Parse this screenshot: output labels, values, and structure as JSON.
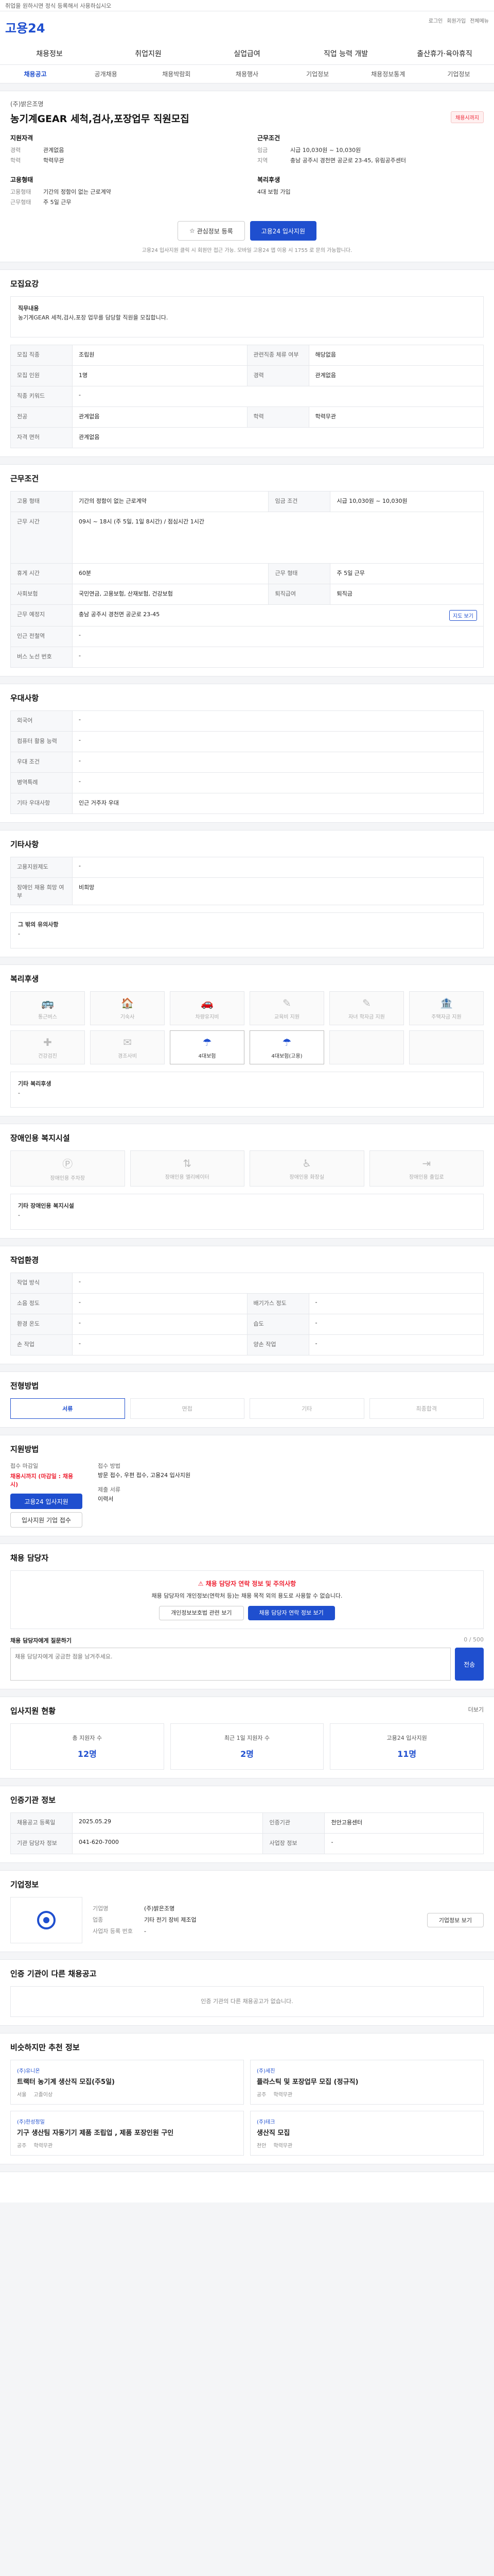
{
  "topbar": {
    "notice": "취업을 원하시면 정식 등록해서 사용하십시오"
  },
  "header": {
    "logo": "고용24",
    "right": [
      "로그인",
      "회원가입",
      "전체메뉴"
    ]
  },
  "gnb": [
    "채용정보",
    "취업지원",
    "실업급여",
    "직업 능력 개발",
    "출산휴가·육아휴직"
  ],
  "gnb2": [
    "채용공고",
    "공개채용",
    "채용박람회",
    "채용행사",
    "기업정보",
    "채용정보통계",
    "기업정보"
  ],
  "job": {
    "company": "(주)밝은조명",
    "title": "농기계GEAR 세척,검사,포장업무 직원모집",
    "badge": "채용시까지",
    "left_head": "지원자격",
    "left_kv": [
      {
        "k": "경력",
        "v": "관계없음"
      },
      {
        "k": "학력",
        "v": "학력무관"
      }
    ],
    "left2_head": "고용형태",
    "left2_kv": [
      {
        "k": "고용형태",
        "v": "기간의 정함이 없는 근로계약"
      },
      {
        "k": "근무형태",
        "v": "주 5일 근무"
      }
    ],
    "right_head": "근무조건",
    "right_kv": [
      {
        "k": "임금",
        "v": "시급 10,030원 ~ 10,030원"
      },
      {
        "k": "지역",
        "v": "충남 공주시 경천면 공군로 23-45, 유림공주센터"
      }
    ],
    "right2_head": "복리후생",
    "right2_kv": [
      {
        "k": "",
        "v": "4대 보험 가입"
      }
    ],
    "btn_scrap": "관심정보 등록",
    "btn_apply": "고용24 입사지원",
    "note": "고용24 입사지원 클릭 시 회원만 접근 가능. 모바일 고용24 앱 이용 시 1755 로 문의 가능합니다."
  },
  "recruit": {
    "title": "모집요강",
    "desc_head": "직무내용",
    "desc": "농기계GEAR 세척,검사,포장 업무를 담당할 직원을 모집합니다.",
    "rows": [
      [
        "모집 직종",
        "조립원",
        "관련직종 체류 여부",
        "해당없음"
      ],
      [
        "모집 인원",
        "1명",
        "경력",
        "관계없음"
      ],
      [
        "직종 키워드",
        "-",
        "",
        ""
      ],
      [
        "전공",
        "관계없음",
        "학력",
        "학력무관"
      ],
      [
        "자격 면허",
        "관계없음",
        "",
        ""
      ]
    ]
  },
  "work": {
    "title": "근무조건",
    "rows": [
      [
        "고용 형태",
        "기간의 정함이 없는 근로계약",
        "임금 조건",
        "시급 10,030원 ~ 10,030원"
      ],
      [
        "근무 시간",
        "09시 ~ 18시 (주 5일, 1일 8시간) / 점심시간 1시간",
        "",
        ""
      ],
      [
        "휴게 시간",
        "60분",
        "근무 형태",
        "주 5일 근무"
      ],
      [
        "사회보험",
        "국민연금, 고용보험, 산재보험, 건강보험",
        "퇴직급여",
        "퇴직금"
      ],
      [
        "근무 예정지",
        "충남 공주시 경천면 공군로 23-45",
        "",
        ""
      ],
      [
        "인근 전철역",
        "-",
        "",
        ""
      ],
      [
        "버스 노선 번호",
        "-",
        "",
        ""
      ]
    ],
    "map_btn": "지도 보기"
  },
  "pref": {
    "title": "우대사항",
    "rows": [
      [
        "외국어",
        "-"
      ],
      [
        "컴퓨터 활용 능력",
        "-"
      ],
      [
        "우대 조건",
        "-"
      ],
      [
        "병역특례",
        "-"
      ],
      [
        "기타 우대사항",
        "인근 거주자 우대"
      ]
    ]
  },
  "etc": {
    "title": "기타사항",
    "rows": [
      [
        "고용지원제도",
        "-"
      ],
      [
        "장애인 채용 희망 여부",
        "비희망"
      ]
    ],
    "apply_notes_head": "그 밖의 유의사항",
    "apply_notes": "-"
  },
  "welfare": {
    "title": "복리후생",
    "items": [
      "통근버스",
      "기숙사",
      "차량유지비",
      "교육비 지원",
      "자녀 학자금 지원",
      "주택자금 지원",
      "건강검진",
      "경조사비",
      "4대보험",
      "4대보험(고용)",
      "",
      ""
    ],
    "active": [
      8,
      9
    ],
    "etc_label": "기타 복리후생",
    "etc_value": "-"
  },
  "disabled": {
    "title": "장애인용 복지시설",
    "items": [
      "장애인용 주차장",
      "장애인용 엘리베이터",
      "장애인용 화장실",
      "장애인용 출입로"
    ],
    "etc_label": "기타 장애인용 복지시설",
    "etc_value": "-"
  },
  "workplace": {
    "title": "작업환경",
    "rows": [
      [
        "작업 방식",
        "-",
        "",
        ""
      ],
      [
        "소음 정도",
        "-",
        "배기가스 정도",
        "-"
      ],
      [
        "환경 온도",
        "-",
        "습도",
        "-"
      ],
      [
        "손 작업",
        "-",
        "양손 작업",
        "-"
      ]
    ]
  },
  "process": {
    "title": "전형방법",
    "steps": [
      "서류",
      "면접",
      "기타",
      "최종합격"
    ]
  },
  "apply": {
    "title": "지원방법",
    "deadline_label": "접수 마감일",
    "deadline": "채용시까지 (마감일 : 채용 시)",
    "btn": "고용24 입사지원",
    "btn2": "입사지원 기업 접수",
    "method_label": "접수 방법",
    "method": "방문 접수, 우편 접수, 고용24 입사지원",
    "docs_label": "제출 서류",
    "docs": "이력서"
  },
  "warn": {
    "title": "채용 담당자",
    "red": "채용 담당자 연락 정보 및 주의사항",
    "text": "채용 담당자의 개인정보(연락처 등)는 채용 목적 외의 용도로 사용할 수 없습니다.",
    "btn1": "개인정보보호법 관련 보기",
    "btn2": "채용 담당자 연락 정보 보기"
  },
  "inquiry": {
    "title": "채용 담당자에게 질문하기",
    "limit": "0 / 500",
    "placeholder": "채용 담당자에게 궁금한 점을 남겨주세요.",
    "btn": "전송"
  },
  "stats": {
    "title": "입사지원 현황",
    "more": "더보기",
    "items": [
      {
        "label": "총 지원자 수",
        "value": "12명"
      },
      {
        "label": "최근 1일 지원자 수",
        "value": "2명"
      },
      {
        "label": "고용24 입사지원",
        "value": "11명"
      }
    ]
  },
  "agency": {
    "title": "인증기관 정보",
    "rows": [
      [
        "채용공고 등록일",
        "2025.05.29",
        "인증기관",
        "천안고용센터"
      ],
      [
        "기관 담당자 정보",
        "041-620-7000",
        "사업장 정보",
        "-"
      ]
    ]
  },
  "company": {
    "title": "기업정보",
    "rows": [
      [
        "기업명",
        "(주)밝은조명"
      ],
      [
        "업종",
        "기타 전기 장비 제조업"
      ],
      [
        "사업자 등록 번호",
        "-"
      ]
    ],
    "btn": "기업정보 보기"
  },
  "others": {
    "title": "인증 기관이 다른 채용공고",
    "empty": "인증 기관의 다른 채용공고가 없습니다."
  },
  "similar": {
    "title": "비슷하지만 추천 정보",
    "cards": [
      {
        "co": "(주)유니온",
        "title": "트랙터 농기계 생산직 모집(주5일)",
        "meta": [
          "서울",
          "고졸이상"
        ]
      },
      {
        "co": "(주)세진",
        "title": "플라스틱 및 포장업무 모집 (정규직)",
        "meta": [
          "공주",
          "학력무관"
        ]
      },
      {
        "co": "(주)한성정밀",
        "title": "기구 생산팀 자동기기 제품 조립업 , 제품 포장인원 구인",
        "meta": [
          "공주",
          "학력무관"
        ]
      },
      {
        "co": "(주)테크",
        "title": "생산직 모집",
        "meta": [
          "천안",
          "학력무관"
        ]
      }
    ]
  }
}
